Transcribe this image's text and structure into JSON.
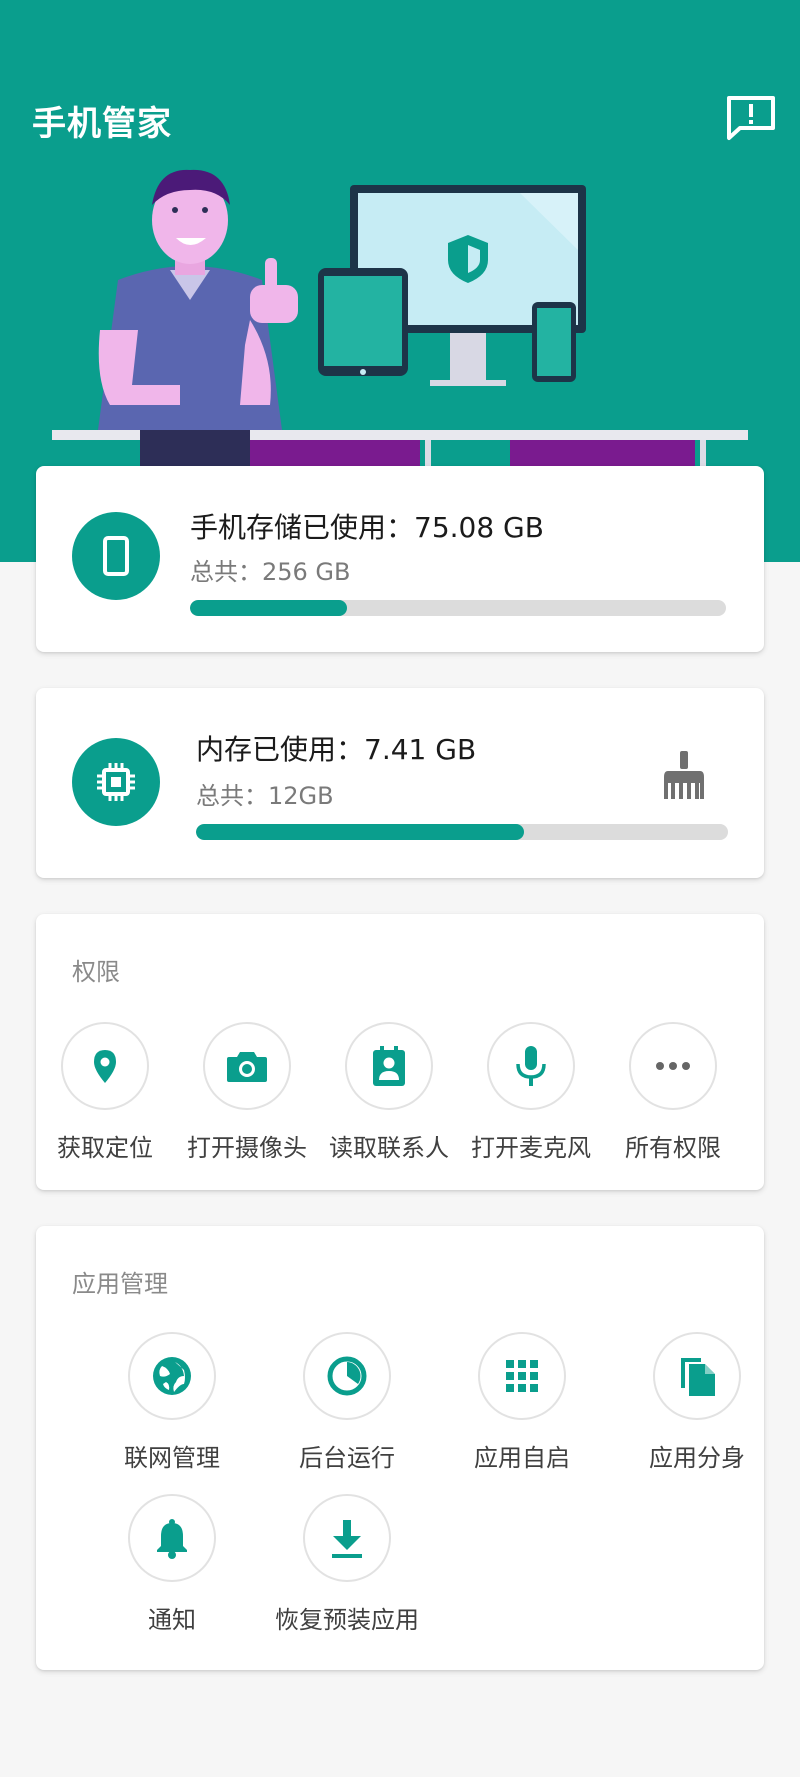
{
  "header": {
    "title": "手机管家",
    "feedback_icon": "feedback-icon",
    "background_color": "#0a9e8d"
  },
  "storage": {
    "title": "手机存储已使用：75.08 GB",
    "total": "总共：256 GB",
    "used_fraction": 0.293,
    "icon": "phone-icon"
  },
  "memory": {
    "title": "内存已使用：7.41 GB",
    "total": "总共：12GB",
    "used_fraction": 0.617,
    "icon": "chip-icon",
    "clean_icon": "broom-icon"
  },
  "permissions": {
    "title": "权限",
    "items": [
      {
        "label": "获取定位",
        "icon": "location-icon"
      },
      {
        "label": "打开摄像头",
        "icon": "camera-icon"
      },
      {
        "label": "读取联系人",
        "icon": "contacts-icon"
      },
      {
        "label": "打开麦克风",
        "icon": "microphone-icon"
      },
      {
        "label": "所有权限",
        "icon": "more-icon"
      }
    ]
  },
  "app_management": {
    "title": "应用管理",
    "items": [
      {
        "label": "联网管理",
        "icon": "globe-icon"
      },
      {
        "label": "后台运行",
        "icon": "pie-chart-icon"
      },
      {
        "label": "应用自启",
        "icon": "apps-grid-icon"
      },
      {
        "label": "应用分身",
        "icon": "copy-icon"
      },
      {
        "label": "通知",
        "icon": "bell-icon"
      },
      {
        "label": "恢复预装应用",
        "icon": "download-icon"
      }
    ]
  },
  "accent_color": "#0a9e8d"
}
